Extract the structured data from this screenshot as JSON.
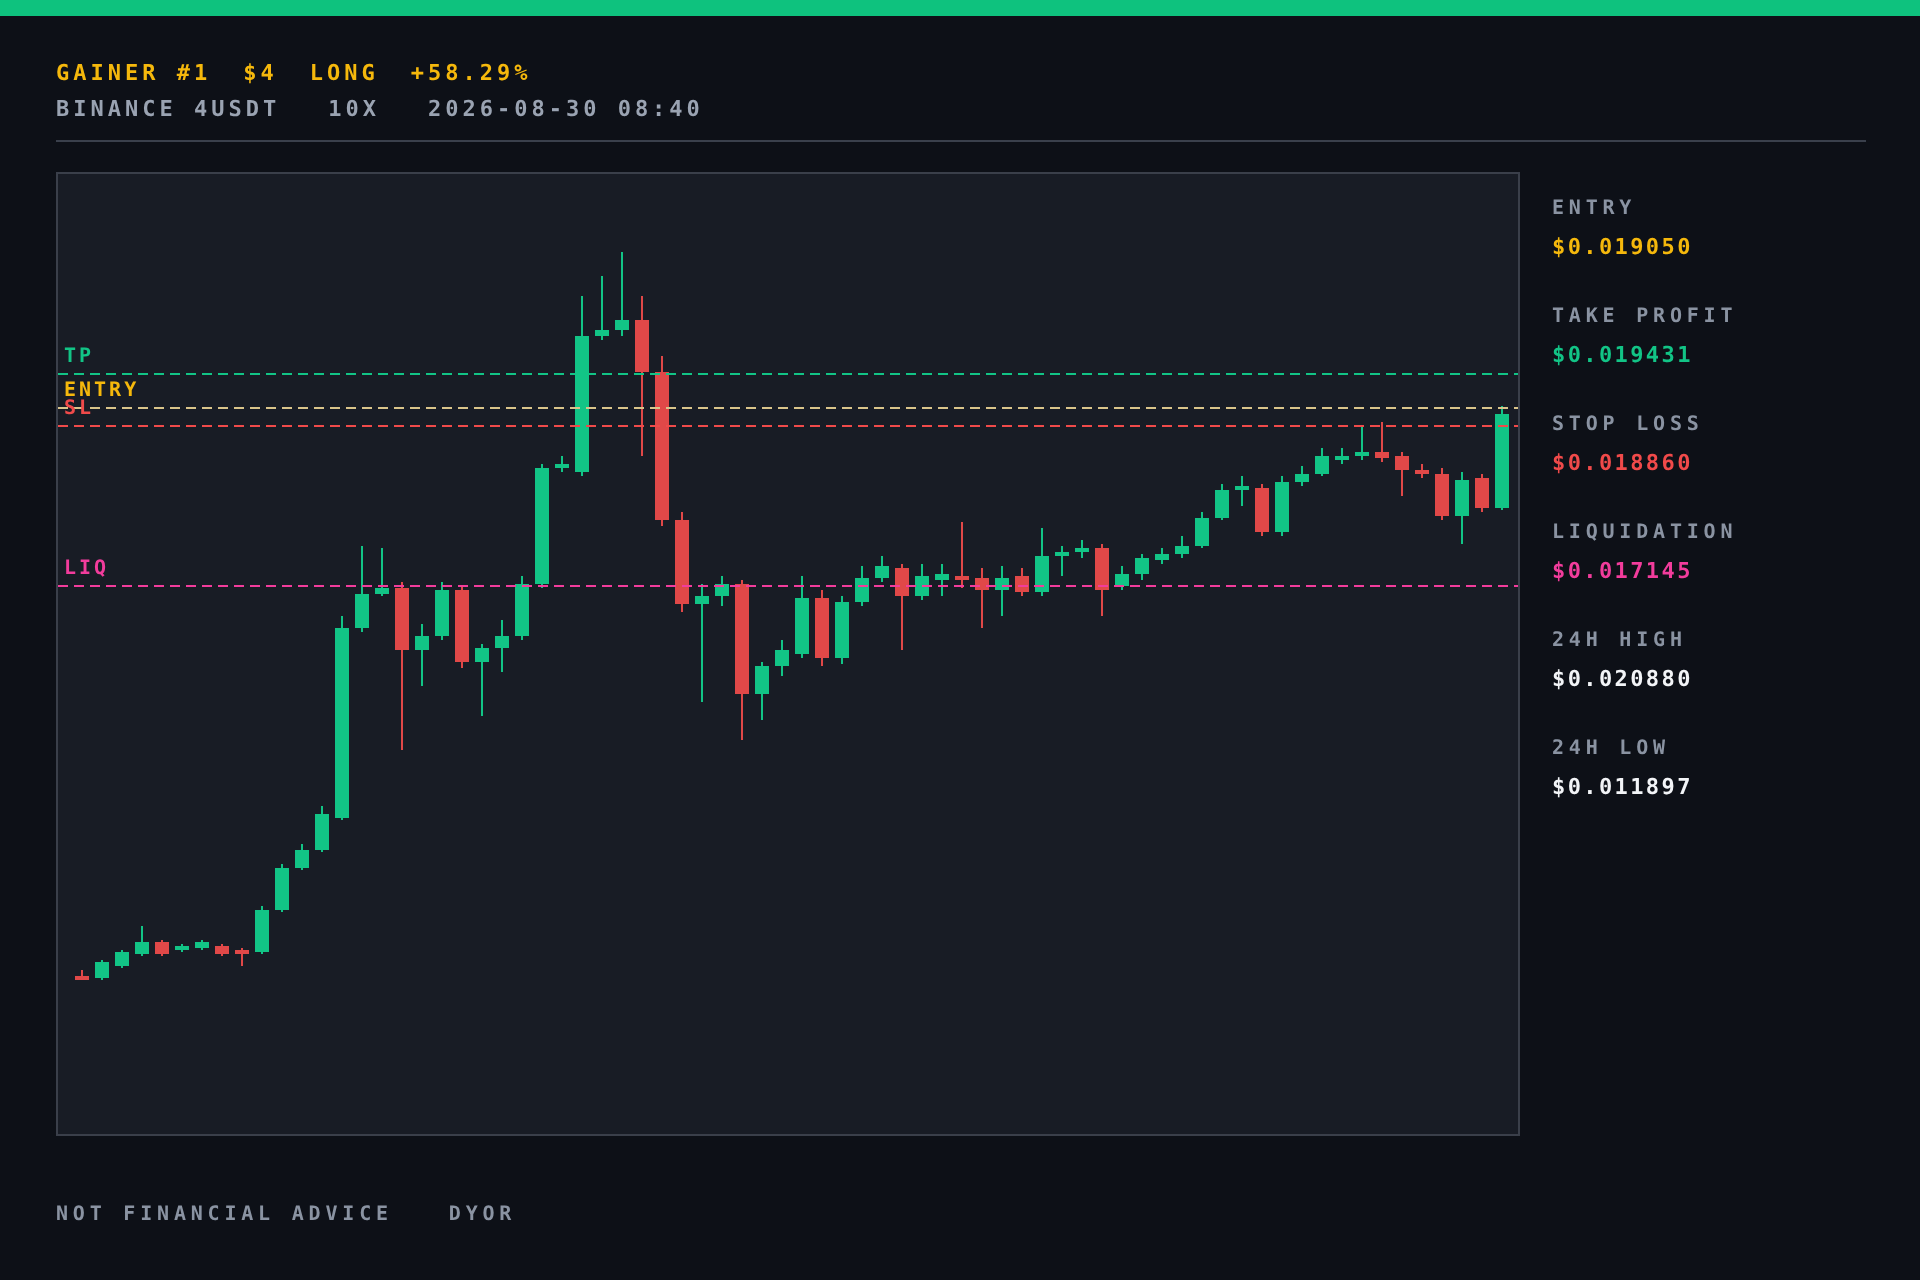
{
  "header": {
    "title": [
      "GAINER #1",
      "$4",
      "LONG",
      "+58.29%"
    ],
    "meta": [
      "BINANCE 4USDT",
      "10X",
      "2026-08-30 08:40"
    ]
  },
  "chart": {
    "levels": [
      {
        "kind": "tp",
        "label": "TP"
      },
      {
        "kind": "entry",
        "label": "ENTRY"
      },
      {
        "kind": "sl",
        "label": "SL"
      },
      {
        "kind": "liq",
        "label": "LIQ"
      }
    ]
  },
  "stats": [
    {
      "label": "ENTRY",
      "value": "$0.019050",
      "color": "#f5b80c"
    },
    {
      "label": "TAKE PROFIT",
      "value": "$0.019431",
      "color": "#12c486"
    },
    {
      "label": "STOP LOSS",
      "value": "$0.018860",
      "color": "#f04a4a"
    },
    {
      "label": "LIQUIDATION",
      "value": "$0.017145",
      "color": "#f23c9c"
    },
    {
      "label": "24H HIGH",
      "value": "$0.020880",
      "color": "#f2f4f7"
    },
    {
      "label": "24H LOW",
      "value": "$0.011897",
      "color": "#f2f4f7"
    }
  ],
  "footer": [
    "NOT FINANCIAL ADVICE",
    "DYOR"
  ]
}
